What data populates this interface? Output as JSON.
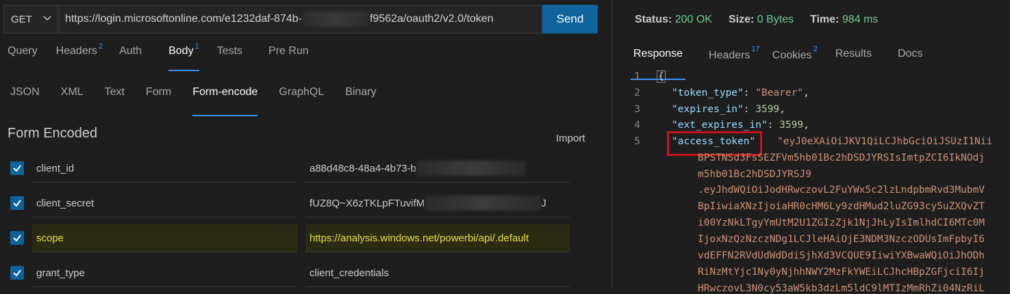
{
  "request": {
    "method": "GET",
    "url_start": "https://login.microsoftonline.com/e1232daf-874b-",
    "url_end": "f9562a/oauth2/v2.0/token",
    "send_label": "Send"
  },
  "req_tabs": [
    {
      "label": "Query",
      "badge": ""
    },
    {
      "label": "Headers",
      "badge": "2"
    },
    {
      "label": "Auth",
      "badge": ""
    },
    {
      "label": "Body",
      "badge": "1"
    },
    {
      "label": "Tests",
      "badge": ""
    },
    {
      "label": "Pre Run",
      "badge": ""
    }
  ],
  "body_tabs": [
    "JSON",
    "XML",
    "Text",
    "Form",
    "Form-encode",
    "GraphQL",
    "Binary"
  ],
  "form": {
    "title": "Form Encoded",
    "import_label": "Import",
    "rows": [
      {
        "key": "client_id",
        "value": "a88d48c8-48a4-4b73-b"
      },
      {
        "key": "client_secret",
        "value": "fUZ8Q~X6zTKLpFTuvifM",
        "value_end": "J"
      },
      {
        "key": "scope",
        "value": "https://analysis.windows.net/powerbi/api/.default"
      },
      {
        "key": "grant_type",
        "value": "client_credentials"
      }
    ]
  },
  "response": {
    "status_label": "Status:",
    "status_value": "200 OK",
    "size_label": "Size:",
    "size_value": "0 Bytes",
    "time_label": "Time:",
    "time_value": "984 ms",
    "tabs": [
      {
        "label": "Response",
        "badge": ""
      },
      {
        "label": "Headers",
        "badge": "17"
      },
      {
        "label": "Cookies",
        "badge": "2"
      },
      {
        "label": "Results",
        "badge": ""
      },
      {
        "label": "Docs",
        "badge": ""
      }
    ],
    "line_numbers": [
      "1",
      "2",
      "3",
      "4",
      "5"
    ],
    "json": {
      "open": "{",
      "token_type_key": "\"token_type\"",
      "token_type_val": "\"Bearer\"",
      "expires_key": "\"expires_in\"",
      "expires_val": "3599",
      "ext_key": "\"ext_expires_in\"",
      "ext_val": "3599",
      "access_key": "\"access_token\"",
      "token_lines": [
        "\"eyJ0eXAiOiJKV1QiLCJhbGciOiJSUzI1Nii",
        "BPSTNSd3FsSEZFVm5hb01Bc2hDSDJYRSIsImtpZCI6IkNOdj",
        "m5hb01Bc2hDSDJYRSJ9",
        ".eyJhdWQiOiJodHRwczovL2FuYWx5c2lzLndpbmRvd3MubmV",
        "BpIiwiaXNzIjoiaHR0cHM6Ly9zdHMud2luZG93cy5uZXQvZT",
        "i00YzNkLTgyYmUtM2U1ZGIzZjk1NjJhLyIsImlhdCI6MTc0M",
        "IjoxNzQzNzczNDg1LCJleHAiOjE3NDM3NzczODUsImFpbyI6",
        "vdEFFN2RVdUdWdDdiSjhXd3VCQUE9IiwiYXBwaWQiOiJhODh",
        "RiNzMtYjc1Ny0yNjhhNWY2MzFkYWEiLCJhcHBpZGFjciI6Ij",
        "HRwczovL3N0cy53aW5kb3dzLm5ldC9lMTIzMmRhZi04NzRiL"
      ]
    }
  }
}
